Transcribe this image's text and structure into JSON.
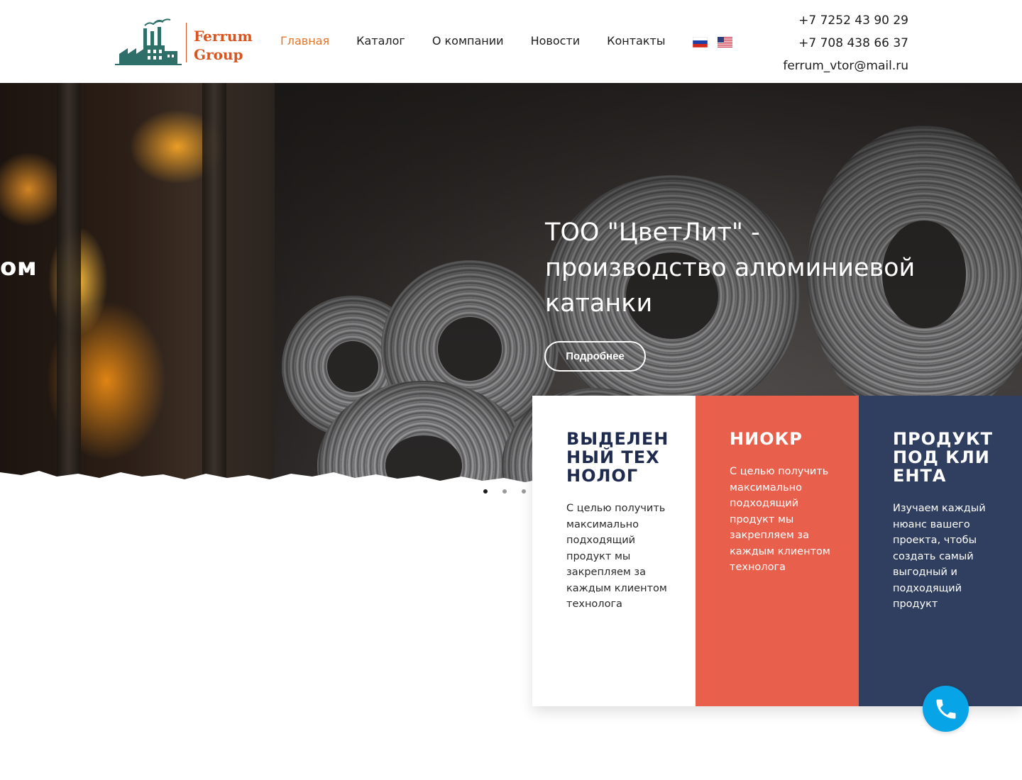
{
  "brand": {
    "logo_line1": "Ferrum",
    "logo_line2": "Group",
    "accent_color": "#d9541e",
    "logo_icon": "factory-icon"
  },
  "nav": {
    "items": [
      {
        "label": "Главная",
        "active": true
      },
      {
        "label": "Каталог",
        "active": false
      },
      {
        "label": "О компании",
        "active": false
      },
      {
        "label": "Новости",
        "active": false
      },
      {
        "label": "Контакты",
        "active": false
      }
    ],
    "active_color": "#e2762c"
  },
  "languages": [
    {
      "icon": "russia-flag-icon"
    },
    {
      "icon": "usa-flag-icon"
    }
  ],
  "contacts": {
    "phone1": "+7 7252 43 90 29",
    "phone2": "+7 708 438 66 37",
    "email": "ferrum_vtor@mail.ru"
  },
  "hero": {
    "prev_slide_text": "ом",
    "title_line1": "ТОО \"ЦветЛит\" -",
    "title_line2": "производство алюминиевой",
    "title_line3": "катанки",
    "button_label": "Подробнее"
  },
  "slider": {
    "dots": 3,
    "active_dot": 0
  },
  "features": [
    {
      "title": "ВЫДЕЛЕННЫЙ ТЕХНОЛОГ",
      "text": "С целью получить максимально подходящий продукт мы закрепляем за каждым клиентом технолога",
      "bg_color": "#ffffff"
    },
    {
      "title": "НИОКР",
      "text": "С целью получить максимально подходящий продукт мы закрепляем за каждым клиентом технолога",
      "bg_color": "#e8604c"
    },
    {
      "title": "ПРОДУКТ ПОД КЛИЕНТА",
      "text": "Изучаем каждый нюанс вашего проекта, чтобы создать самый выгодный и подходящий продукт",
      "bg_color": "#303e5f"
    }
  ],
  "call_button": {
    "icon": "phone-icon",
    "color": "#08a4e8"
  }
}
